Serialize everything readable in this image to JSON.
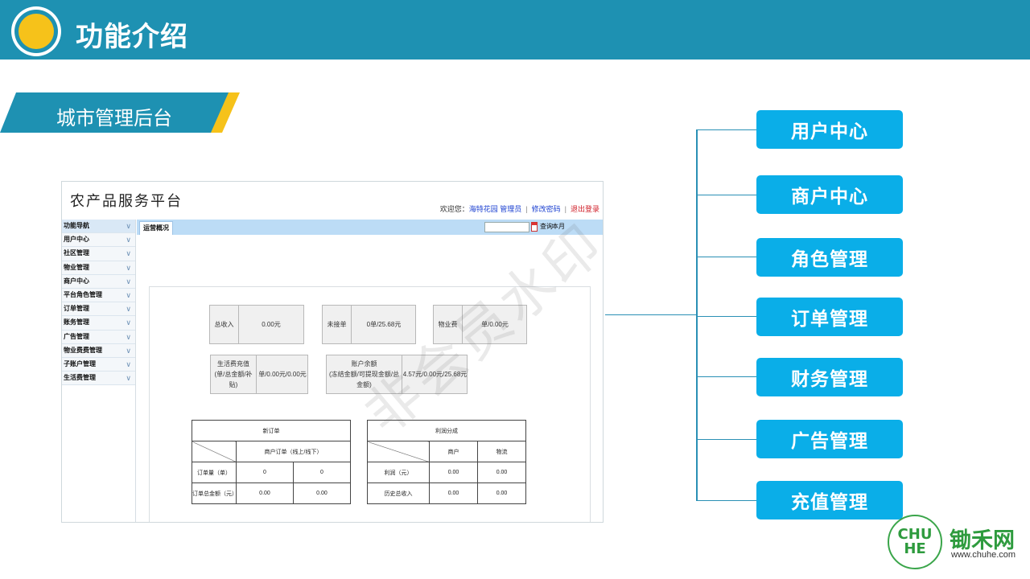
{
  "header": {
    "title": "功能介绍",
    "accent": "#1e91b2",
    "highlight": "#f6c21a"
  },
  "section": {
    "label": "城市管理后台"
  },
  "app": {
    "title": "农产品服务平台",
    "userbar": {
      "welcome": "欢迎您：",
      "user": "海特花园 管理员",
      "change_password": "修改密码",
      "logout": "退出登录",
      "sep": "|"
    },
    "nav": [
      {
        "label": "功能导航"
      },
      {
        "label": "用户中心"
      },
      {
        "label": "社区管理"
      },
      {
        "label": "物业管理"
      },
      {
        "label": "商户中心"
      },
      {
        "label": "平台角色管理"
      },
      {
        "label": "订单管理"
      },
      {
        "label": "账务管理"
      },
      {
        "label": "广告管理"
      },
      {
        "label": "物业费费管理"
      },
      {
        "label": "子账户管理"
      },
      {
        "label": "生活费管理"
      }
    ],
    "nav_chevron": "∨",
    "tab": "运营概况",
    "query_button": "查询",
    "month_button": "本月",
    "stats": {
      "total_income": {
        "label": "总收入",
        "value": "0.00元"
      },
      "pending_orders": {
        "label": "未接单",
        "value": "0单/25.68元"
      },
      "property_fee": {
        "label": "物业费",
        "value": "单/0.00元"
      },
      "living_recharge": {
        "label_line1": "生活费充值",
        "label_line2": "(单/总金额/补贴)",
        "value": "单/0.00元/0.00元"
      },
      "account_balance": {
        "label_line1": "账户余额",
        "label_line2": "(冻结金额/可提现金额/总金额)",
        "value": "4.57元/0.00元/25.68元"
      }
    },
    "new_orders_table": {
      "title": "新订单",
      "subheader": "商户订单（线上/线下）",
      "rows": [
        {
          "label": "订单量（单）",
          "a": "0",
          "b": "0"
        },
        {
          "label": "订单总金额（元）",
          "a": "0.00",
          "b": "0.00"
        }
      ]
    },
    "profit_table": {
      "title": "利润分成",
      "col1": "商户",
      "col2": "物流",
      "rows": [
        {
          "label": "利润（元）",
          "a": "0.00",
          "b": "0.00"
        },
        {
          "label": "历史总收入",
          "a": "0.00",
          "b": "0.00"
        }
      ]
    }
  },
  "watermark": "非会员水印",
  "features": [
    "用户中心",
    "商户中心",
    "角色管理",
    "订单管理",
    "财务管理",
    "广告管理",
    "充值管理"
  ],
  "feature_color": "#0aaee8",
  "brand": {
    "logo_text": "CHU HE",
    "name": "锄禾网",
    "url": "www.chuhe.com",
    "color": "#2e9b3e"
  }
}
